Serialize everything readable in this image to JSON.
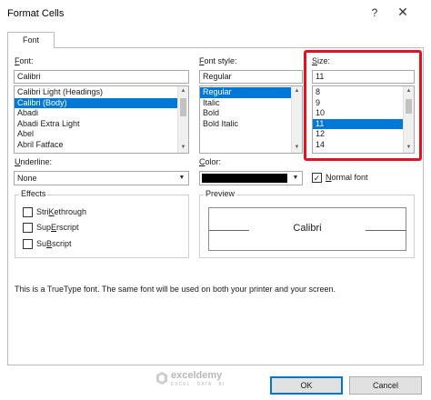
{
  "window": {
    "title": "Format Cells",
    "help_glyph": "?",
    "close_glyph": "✕"
  },
  "tabs": [
    {
      "label": "Font"
    }
  ],
  "font": {
    "label_rest": "ont:",
    "label_key": "F",
    "value": "Calibri",
    "items": [
      "Calibri Light (Headings)",
      "Calibri (Body)",
      "Abadi",
      "Abadi Extra Light",
      "Abel",
      "Abril Fatface"
    ],
    "selected_index": 1
  },
  "font_style": {
    "label_rest": "ont style:",
    "label_key": "F",
    "value": "Regular",
    "items": [
      "Regular",
      "Italic",
      "Bold",
      "Bold Italic"
    ],
    "selected_index": 0
  },
  "size": {
    "label_key": "S",
    "label_rest": "ize:",
    "value": "11",
    "items": [
      "8",
      "9",
      "10",
      "11",
      "12",
      "14"
    ],
    "selected_index": 3,
    "highlight_color": "#e0141e"
  },
  "underline": {
    "label_key": "U",
    "label_rest": "nderline:",
    "value": "None"
  },
  "color": {
    "label_key": "C",
    "label_rest": "olor:",
    "swatch": "#000000"
  },
  "normal_font": {
    "label_key": "N",
    "label_rest": "ormal font",
    "checked": true
  },
  "effects": {
    "title": "Effects",
    "strikethrough": {
      "key": "K",
      "before": "Stri",
      "after": "ethrough"
    },
    "superscript": {
      "key": "E",
      "before": "Sup",
      "after": "rscript"
    },
    "subscript": {
      "key": "B",
      "before": "Su",
      "after": "script"
    }
  },
  "preview": {
    "title": "Preview",
    "sample": "Calibri"
  },
  "info_text": "This is a TrueType font.  The same font will be used on both your printer and your screen.",
  "buttons": {
    "ok": "OK",
    "cancel": "Cancel"
  },
  "watermark": {
    "brand": "exceldemy",
    "tagline": "EXCEL · DATA · BI"
  },
  "colors": {
    "selection": "#0078d7",
    "highlight": "#e0141e"
  }
}
